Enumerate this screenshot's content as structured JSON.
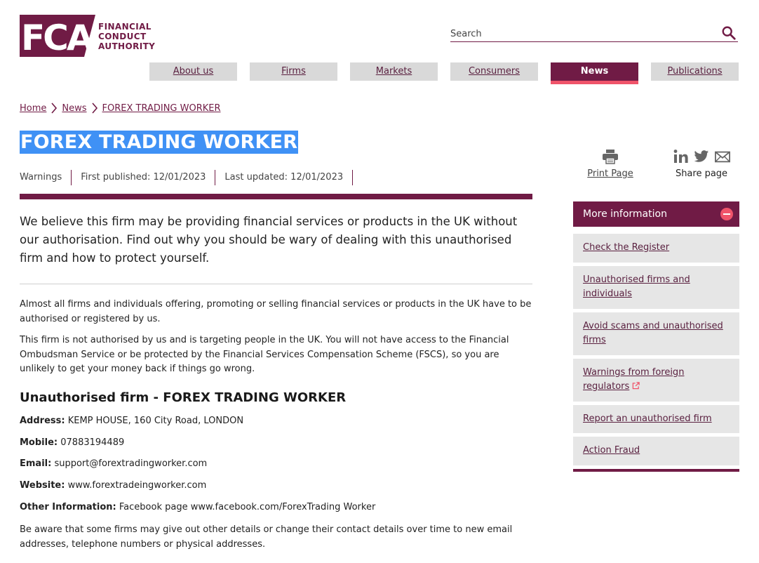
{
  "header": {
    "logo_letters": "FCA",
    "logo_text_lines": [
      "FINANCIAL",
      "CONDUCT",
      "AUTHORITY"
    ],
    "search_placeholder": "Search",
    "search_icon": "search-icon"
  },
  "nav": {
    "items": [
      {
        "label": "About us",
        "active": false
      },
      {
        "label": "Firms",
        "active": false
      },
      {
        "label": "Markets",
        "active": false
      },
      {
        "label": "Consumers",
        "active": false
      },
      {
        "label": "News",
        "active": true
      },
      {
        "label": "Publications",
        "active": false
      }
    ]
  },
  "breadcrumb": [
    "Home",
    "News",
    "FOREX TRADING WORKER"
  ],
  "page": {
    "title": "FOREX TRADING WORKER",
    "meta": [
      "Warnings",
      "First published: 12/01/2023",
      "Last updated: 12/01/2023"
    ],
    "lead": "We believe this firm may be providing financial services or products in the UK without our authorisation. Find out why you should be wary of dealing with this unauthorised firm and how to protect yourself.",
    "para1": "Almost all firms and individuals offering, promoting or selling financial services or products in the UK have to be authorised or registered by us.",
    "para2": "This firm is not authorised by us and is targeting people in the UK. You will not have access to the Financial Ombudsman Service or be protected by the Financial Services Compensation Scheme (FSCS), so you are unlikely to get your money back if things go wrong.",
    "firm_heading": "Unauthorised firm - FOREX TRADING WORKER",
    "details": [
      {
        "label": "Address:",
        "value": "KEMP HOUSE, 160 City Road, LONDON"
      },
      {
        "label": "Mobile:",
        "value": "07883194489"
      },
      {
        "label": "Email:",
        "value": "support@forextradingworker.com"
      },
      {
        "label": "Website:",
        "value": "www.forextradeingworker.com"
      },
      {
        "label": "Other Information:",
        "value": "Facebook page www.facebook.com/ForexTrading Worker"
      }
    ],
    "para3": "Be aware that some firms may give out other details or change their contact details over time to new email addresses, telephone numbers or physical addresses."
  },
  "tools": {
    "print_label": "Print Page",
    "share_label": "Share page"
  },
  "sidebar": {
    "title": "More information",
    "links": [
      "Check the Register",
      "Unauthorised firms and individuals",
      "Avoid scams and unauthorised firms",
      "Warnings from foreign regulators",
      "Report an unauthorised firm",
      "Action Fraud"
    ]
  },
  "colors": {
    "brand": "#701b45",
    "accent": "#f0546a",
    "nav_bg": "#d9d9d9",
    "selection": "#3f91f5"
  }
}
